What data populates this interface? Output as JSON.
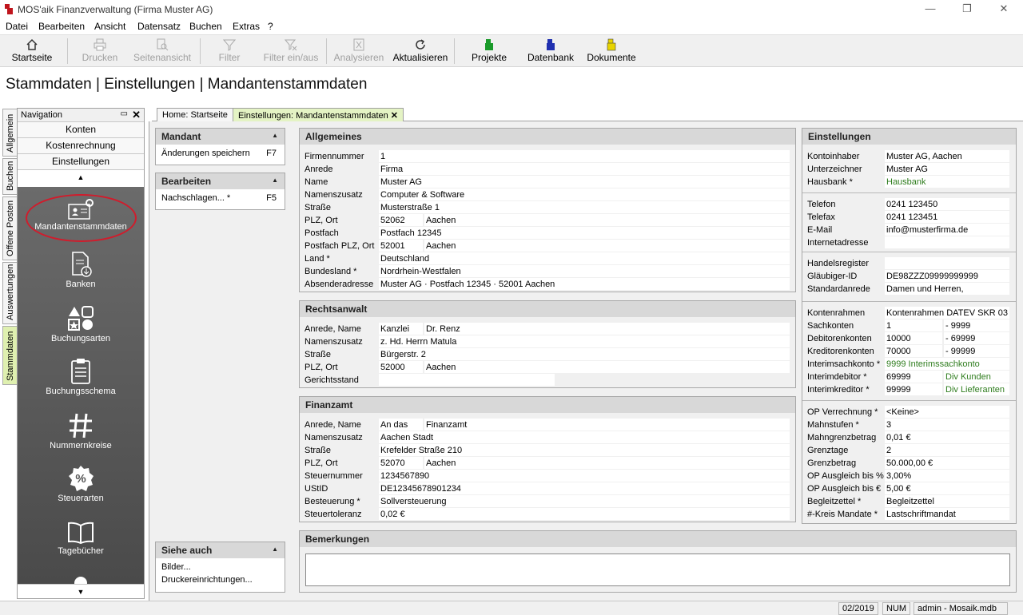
{
  "window": {
    "title": "MOS'aik Finanzverwaltung (Firma Muster AG)",
    "minimize": "—",
    "restore": "❐",
    "close": "✕"
  },
  "menu": [
    "Datei",
    "Bearbeiten",
    "Ansicht",
    "Datensatz",
    "Buchen",
    "Extras",
    "?"
  ],
  "toolbar": {
    "startseite": "Startseite",
    "drucken": "Drucken",
    "seitenansicht": "Seitenansicht",
    "filter": "Filter",
    "filter_einaus": "Filter ein/aus",
    "analysieren": "Analysieren",
    "aktualisieren": "Aktualisieren",
    "projekte": "Projekte",
    "datenbank": "Datenbank",
    "dokumente": "Dokumente"
  },
  "page_title": "Stammdaten | Einstellungen | Mandantenstammdaten",
  "vtabs": [
    "Allgemein",
    "Buchen",
    "Offene Posten",
    "Auswertungen",
    "Stammdaten"
  ],
  "nav": {
    "title": "Navigation",
    "pin": "📌",
    "close": "✕",
    "items": [
      "Konten",
      "Kostenrechnung",
      "Einstellungen"
    ],
    "up": "▲",
    "down": "▼",
    "icons": [
      "Mandantenstammdaten",
      "Banken",
      "Buchungsarten",
      "Buchungsschema",
      "Nummernkreise",
      "Steuerarten",
      "Tagebücher"
    ]
  },
  "doc_tabs": [
    "Home: Startseite",
    "Einstellungen: Mandantenstammdaten"
  ],
  "doc_tab_close": "✕",
  "mandant": {
    "title": "Mandant",
    "collapse": "▲",
    "item": "Änderungen speichern",
    "key": "F7"
  },
  "bearbeiten": {
    "title": "Bearbeiten",
    "collapse": "▲",
    "item": "Nachschlagen... *",
    "key": "F5"
  },
  "siehe": {
    "title": "Siehe auch",
    "collapse": "▲",
    "items": [
      "Bilder...",
      "Druckereinrichtungen..."
    ]
  },
  "allgemeines": {
    "title": "Allgemeines",
    "rows": [
      {
        "k": "Firmennummer",
        "v": "1"
      },
      {
        "k": "Anrede",
        "v": "Firma"
      },
      {
        "k": "Name",
        "v": "Muster AG"
      },
      {
        "k": "Namenszusatz",
        "v": "Computer & Software"
      },
      {
        "k": "Straße",
        "v": "Musterstraße 1"
      },
      {
        "k": "PLZ, Ort",
        "v": "52062",
        "v2": "Aachen"
      },
      {
        "k": "Postfach",
        "v": "Postfach 12345"
      },
      {
        "k": "Postfach PLZ, Ort",
        "v": "52001",
        "v2": "Aachen"
      },
      {
        "k": "Land *",
        "v": "Deutschland"
      },
      {
        "k": "Bundesland *",
        "v": "Nordrhein-Westfalen"
      },
      {
        "k": "Absenderadresse",
        "v": "Muster AG · Postfach 12345 · 52001 Aachen"
      }
    ]
  },
  "rechtsanwalt": {
    "title": "Rechtsanwalt",
    "rows": [
      {
        "k": "Anrede, Name",
        "v": "Kanzlei",
        "v2": "Dr. Renz"
      },
      {
        "k": "Namenszusatz",
        "v": "z. Hd. Herrn Matula"
      },
      {
        "k": "Straße",
        "v": "Bürgerstr. 2"
      },
      {
        "k": "PLZ, Ort",
        "v": "52000",
        "v2": "Aachen"
      },
      {
        "k": "Gerichtsstand",
        "v": ""
      }
    ]
  },
  "finanzamt": {
    "title": "Finanzamt",
    "rows": [
      {
        "k": "Anrede, Name",
        "v": "An das",
        "v2": "Finanzamt"
      },
      {
        "k": "Namenszusatz",
        "v": "Aachen Stadt"
      },
      {
        "k": "Straße",
        "v": "Krefelder Straße 210"
      },
      {
        "k": "PLZ, Ort",
        "v": "52070",
        "v2": "Aachen"
      },
      {
        "k": "Steuernummer",
        "v": "1234567890"
      },
      {
        "k": "UStID",
        "v": "DE12345678901234"
      },
      {
        "k": "Besteuerung *",
        "v": "Sollversteuerung"
      },
      {
        "k": "Steuertoleranz",
        "v": "0,02 €"
      }
    ]
  },
  "bemerkungen": {
    "title": "Bemerkungen",
    "value": ""
  },
  "einstellungen": {
    "title": "Einstellungen",
    "g1": [
      {
        "k": "Kontoinhaber",
        "v": "Muster AG, Aachen"
      },
      {
        "k": "Unterzeichner",
        "v": "Muster AG"
      },
      {
        "k": "Hausbank *",
        "v": "Hausbank",
        "green": true
      }
    ],
    "g2": [
      {
        "k": "Telefon",
        "v": "0241 123450"
      },
      {
        "k": "Telefax",
        "v": "0241 123451"
      },
      {
        "k": "E-Mail",
        "v": "info@musterfirma.de"
      },
      {
        "k": "Internetadresse",
        "v": ""
      }
    ],
    "g3": [
      {
        "k": "Handelsregister",
        "v": ""
      },
      {
        "k": "Gläubiger-ID",
        "v": "DE98ZZZ09999999999"
      },
      {
        "k": "Standardanrede",
        "v": "Damen und Herren,"
      }
    ],
    "g4": [
      {
        "k": "Kontenrahmen",
        "v": "Kontenrahmen DATEV SKR 03"
      },
      {
        "k": "Sachkonten",
        "v": "1",
        "v2": "- 9999"
      },
      {
        "k": "Debitorenkonten",
        "v": "10000",
        "v2": "- 69999"
      },
      {
        "k": "Kreditorenkonten",
        "v": "70000",
        "v2": "- 99999"
      },
      {
        "k": "Interimsachkonto *",
        "v": "9999 Interimssachkonto",
        "green": true
      },
      {
        "k": "Interimdebitor *",
        "v": "69999",
        "v2": "Div Kunden",
        "green2": true
      },
      {
        "k": "Interimkreditor *",
        "v": "99999",
        "v2": "Div Lieferanten",
        "green2": true
      }
    ],
    "g5": [
      {
        "k": "OP Verrechnung *",
        "v": "<Keine>"
      },
      {
        "k": "Mahnstufen *",
        "v": "3"
      },
      {
        "k": "Mahngrenzbetrag",
        "v": "0,01 €"
      },
      {
        "k": "Grenztage",
        "v": "2"
      },
      {
        "k": "Grenzbetrag",
        "v": "50.000,00 €"
      },
      {
        "k": "OP Ausgleich bis %",
        "v": "3,00%"
      },
      {
        "k": "OP Ausgleich bis €",
        "v": "5,00 €"
      },
      {
        "k": "Begleitzettel *",
        "v": "Begleitzettel"
      },
      {
        "k": "#-Kreis Mandate *",
        "v": "Lastschriftmandat"
      }
    ]
  },
  "status": {
    "period": "02/2019",
    "num": "NUM",
    "user": "admin - Mosaik.mdb"
  }
}
